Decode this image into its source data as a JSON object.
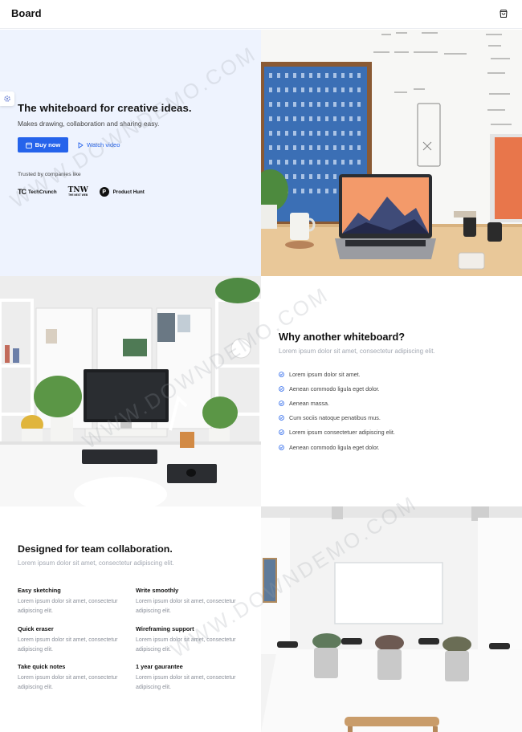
{
  "header": {
    "brand": "Board",
    "cart_icon": "shopping-bag-icon"
  },
  "settings_icon": "gear-icon",
  "hero": {
    "title": "The whiteboard for creative ideas.",
    "subtitle": "Makes drawing, collaboration and sharing easy.",
    "buy_label": "Buy now",
    "watch_label": "Watch video",
    "trusted_label": "Trusted by companies like",
    "logos": [
      {
        "mark": "TC",
        "name": "TechCrunch"
      },
      {
        "mark": "TNW",
        "name": "THE NEXT WEB"
      },
      {
        "mark": "P",
        "name": "Product Hunt"
      }
    ],
    "accent": "#2563eb",
    "background": "#eef3fe"
  },
  "why": {
    "title": "Why another whiteboard?",
    "lead": "Lorem ipsum dolor sit amet, consectetur adipiscing elit.",
    "items": [
      "Lorem ipsum dolor sit amet.",
      "Aenean commodo ligula eget dolor.",
      "Aenean massa.",
      "Cum sociis natoque penatibus mus.",
      "Lorem ipsum consectetuer adipiscing elit.",
      "Aenean commodo ligula eget dolor."
    ]
  },
  "design": {
    "title": "Designed for team collaboration.",
    "lead": "Lorem ipsum dolor sit amet, consectetur adipiscing elit.",
    "features": [
      {
        "title": "Easy sketching",
        "desc": "Lorem ipsum dolor sit amet, consectetur adipiscing elit."
      },
      {
        "title": "Write smoothly",
        "desc": "Lorem ipsum dolor sit amet, consectetur adipiscing elit."
      },
      {
        "title": "Quick eraser",
        "desc": "Lorem ipsum dolor sit amet, consectetur adipiscing elit."
      },
      {
        "title": "Wireframing support",
        "desc": "Lorem ipsum dolor sit amet, consectetur adipiscing elit."
      },
      {
        "title": "Take quick notes",
        "desc": "Lorem ipsum dolor sit amet, consectetur adipiscing elit."
      },
      {
        "title": "1 year gaurantee",
        "desc": "Lorem ipsum dolor sit amet, consectetur adipiscing elit."
      }
    ]
  },
  "watermark": "WWW.DOWNDEMO.COM"
}
